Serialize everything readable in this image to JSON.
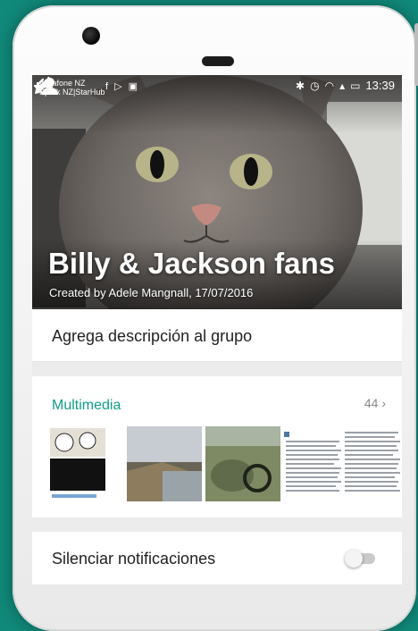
{
  "status_bar": {
    "carrier_line1": "vodafone NZ",
    "carrier_line2": "Spark NZ|StarHub",
    "time": "13:39"
  },
  "group": {
    "name": "Billy & Jackson fans",
    "created_by": "Created by Adele Mangnall, 17/07/2016"
  },
  "description": {
    "placeholder": "Agrega descripción al grupo"
  },
  "media": {
    "title": "Multimedia",
    "count": "44",
    "thumbnail_icons": [
      "comic-thumbnail",
      "harbor-photo-thumbnail",
      "rocks-photo-thumbnail",
      "article-screenshot-thumbnail"
    ]
  },
  "mute": {
    "label": "Silenciar notificaciones",
    "enabled": false
  },
  "colors": {
    "accent": "#0f9d86",
    "background": "#10897a"
  }
}
